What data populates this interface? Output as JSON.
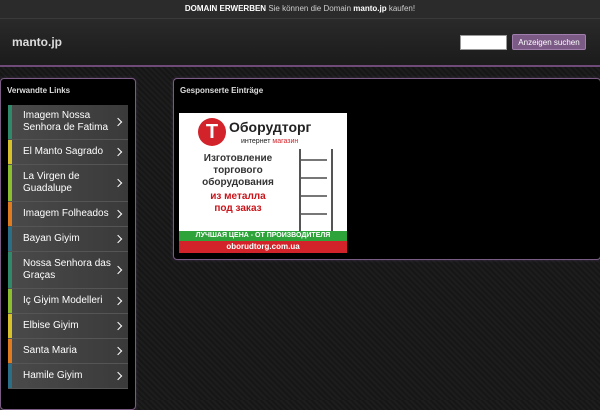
{
  "topbar": {
    "label": "DOMAIN ERWERBEN",
    "text_before": "Sie können die Domain",
    "domain": "manto.jp",
    "text_after": "kaufen!"
  },
  "header": {
    "site_title": "manto.jp",
    "search_placeholder": "",
    "search_button": "Anzeigen suchen"
  },
  "sidebar": {
    "title": "Verwandte Links",
    "items": [
      {
        "label": "Imagem Nossa Senhora de Fatima",
        "color": "#2f8a6b"
      },
      {
        "label": "El Manto Sagrado",
        "color": "#d8c22b"
      },
      {
        "label": "La Virgen de Guadalupe",
        "color": "#8bbf2f"
      },
      {
        "label": "Imagem Folheados",
        "color": "#e07b1f"
      },
      {
        "label": "Bayan Giyim",
        "color": "#2b6f86"
      },
      {
        "label": "Nossa Senhora das Graças",
        "color": "#2f8a6b"
      },
      {
        "label": "Iç Giyim Modelleri",
        "color": "#8bbf2f"
      },
      {
        "label": "Elbise Giyim",
        "color": "#d8c22b"
      },
      {
        "label": "Santa Maria",
        "color": "#e07b1f"
      },
      {
        "label": "Hamile Giyim",
        "color": "#2b6f86"
      }
    ]
  },
  "main": {
    "title": "Gesponserte Einträge",
    "ad": {
      "brand": "Оборудторг",
      "sub_1": "интернет",
      "sub_2": "магазин",
      "line1": "Изготовление",
      "line2": "торгового",
      "line3": "оборудования",
      "line4": "из металла",
      "line5": "под заказ",
      "slogan": "ЛУЧШАЯ ЦЕНА - ОТ ПРОИЗВОДИТЕЛЯ",
      "url": "oborudtorg.com.ua"
    }
  }
}
